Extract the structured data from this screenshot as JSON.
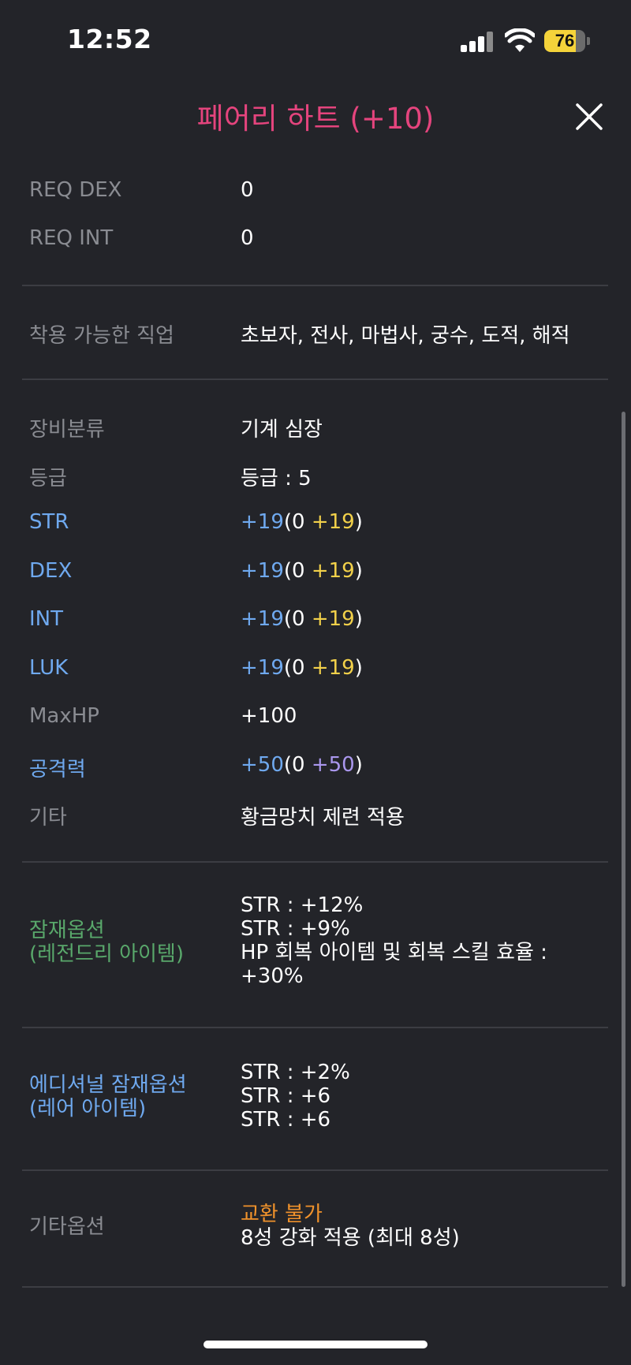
{
  "status": {
    "time": "12:52",
    "battery": "76",
    "battery_level": 0.76
  },
  "header": {
    "title": "페어리 하트 (+10)"
  },
  "req": [
    {
      "label": "REQ DEX",
      "value": "0"
    },
    {
      "label": "REQ INT",
      "value": "0"
    }
  ],
  "jobs": {
    "label": "착용 가능한 직업",
    "value": "초보자, 전사, 마법사, 궁수, 도적, 해적"
  },
  "info": {
    "category_label": "장비분류",
    "category_value": "기계 심장",
    "grade_label": "등급",
    "grade_value": "등급 : 5",
    "maxhp_label": "MaxHP",
    "maxhp_value": "+100",
    "etc_label": "기타",
    "etc_value": "황금망치 제련 적용"
  },
  "stats": [
    {
      "label": "STR",
      "total": "+19",
      "open": "(0 ",
      "bonus": "+19",
      "close": ")"
    },
    {
      "label": "DEX",
      "total": "+19",
      "open": "(0 ",
      "bonus": "+19",
      "close": ")"
    },
    {
      "label": "INT",
      "total": "+19",
      "open": "(0 ",
      "bonus": "+19",
      "close": ")"
    },
    {
      "label": "LUK",
      "total": "+19",
      "open": "(0 ",
      "bonus": "+19",
      "close": ")"
    }
  ],
  "attack": {
    "label": "공격력",
    "total": "+50",
    "open": "(0 ",
    "bonus": "+50",
    "close": ")"
  },
  "potential": {
    "label1": "잠재옵션",
    "label2": "(레전드리 아이템)",
    "lines": [
      "STR : +12%",
      "STR : +9%",
      "HP 회복 아이템 및 회복 스킬 효율 :",
      "+30%"
    ]
  },
  "additional": {
    "label1": "에디셔널 잠재옵션",
    "label2": "(레어 아이템)",
    "lines": [
      "STR : +2%",
      "STR : +6",
      "STR : +6"
    ]
  },
  "etc_options": {
    "label": "기타옵션",
    "line1": "교환 불가",
    "line2": "8성 강화 적용 (최대 8성)"
  },
  "colors": {
    "title": "#e4447d",
    "stat_blue": "#6fa9ef",
    "bonus_yellow": "#f2d14a",
    "bonus_purple": "#aa97ee",
    "legendary_green": "#59a86b",
    "untradeable_orange": "#f0922b",
    "background": "#232429"
  },
  "icons": {
    "close": "close-icon",
    "signal": "cellular-signal-icon",
    "wifi": "wifi-icon",
    "battery": "battery-icon"
  }
}
